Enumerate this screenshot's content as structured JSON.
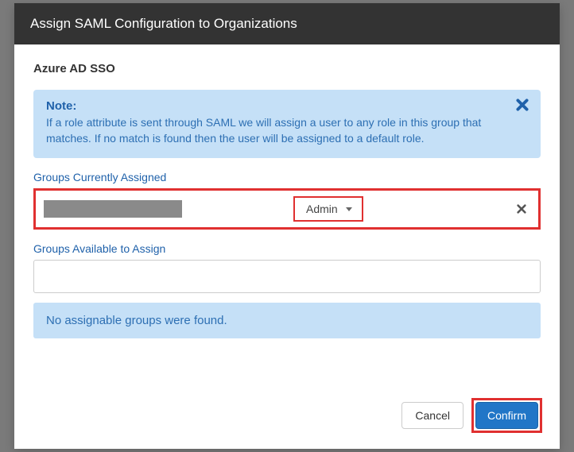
{
  "header": {
    "title": "Assign SAML Configuration to Organizations"
  },
  "config_name": "Azure AD SSO",
  "note": {
    "title": "Note:",
    "text": "If a role attribute is sent through SAML we will assign a user to any role in this group that matches. If no match is found then the user will be assigned to a default role."
  },
  "sections": {
    "assigned_label": "Groups Currently Assigned",
    "available_label": "Groups Available to Assign"
  },
  "assigned": {
    "items": [
      {
        "name_redacted": true,
        "role": "Admin"
      }
    ]
  },
  "available": {
    "search_value": "",
    "empty_message": "No assignable groups were found."
  },
  "footer": {
    "cancel": "Cancel",
    "confirm": "Confirm"
  }
}
